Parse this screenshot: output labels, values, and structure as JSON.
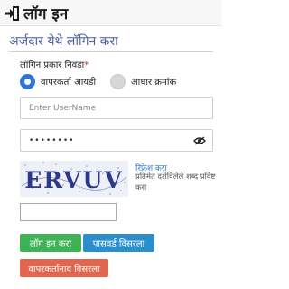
{
  "header": {
    "title": "लॉग इन"
  },
  "form": {
    "subtitle": "अर्जदार येथे लॉगिन करा",
    "login_type_label": "लॉगिन प्रकार निवडा",
    "required_mark": "*",
    "login_type_options": [
      {
        "label": "वापरकर्ता आयडी",
        "selected": true
      },
      {
        "label": "आधार क्रमांक",
        "selected": false
      }
    ],
    "username_placeholder": "Enter UserName",
    "password_value": "••••••••"
  },
  "captcha": {
    "text": "ERVUV",
    "refresh_label": "रिफ्रेश करा",
    "hint": "प्रतिमेत दर्शविलेले शब्द प्रविष्ट करा",
    "input_value": ""
  },
  "buttons": {
    "login": "लॉग इन करा",
    "forgot_password": "पासवर्ड विसरला",
    "forgot_username": "वापरकर्तानाव विसरला"
  },
  "icons": {
    "header": "login-arrow-icon",
    "password_toggle": "eye-slash-icon"
  },
  "colors": {
    "accent_blue": "#2a76d2",
    "login_green": "#3db356",
    "forgot_pw_blue": "#2b8fcc",
    "forgot_user_red": "#e2664e",
    "subtitle_blue": "#4a5fa3"
  }
}
